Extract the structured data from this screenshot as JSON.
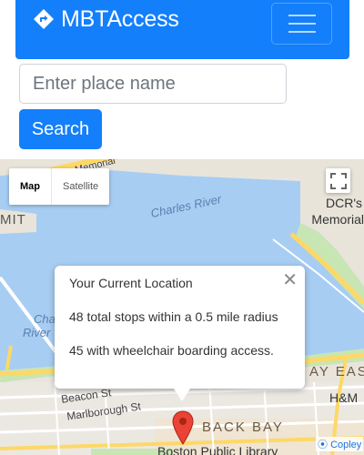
{
  "navbar": {
    "brand_title": "MBTAccess",
    "brand_icon": "directions-icon",
    "toggler_icon": "hamburger-menu-icon",
    "color": "#137ffb"
  },
  "search": {
    "placeholder": "Enter place name",
    "value": "",
    "button_label": "Search"
  },
  "map": {
    "type_controls": {
      "map_label": "Map",
      "satellite_label": "Satellite",
      "selected": "Map"
    },
    "fullscreen_icon": "fullscreen-icon",
    "labels": {
      "memorial_dr": "Memorial",
      "mit": "MIT",
      "charles_river": "Charles River",
      "dcr": "DCR's",
      "memorial": "Memorial",
      "charles_river_partial_1": "Cha",
      "charles_river_partial_2": "River",
      "back_bay_east": "AY EAS",
      "hm": "H&M",
      "beacon_st": "Beacon St",
      "marlborough_st": "Marlborough St",
      "back_bay": "BACK BAY",
      "boston_public_library": "Boston Public Library",
      "copley": "Copley"
    },
    "info_window": {
      "title": "Your Current Location",
      "stops_line": "48 total stops within a 0.5 mile radius",
      "wheelchair_line": "45 with wheelchair boarding access.",
      "close_icon": "close-icon"
    },
    "marker_icon": "map-pin-icon",
    "colors": {
      "water": "#a7cdf2",
      "road": "#fdd866",
      "park": "#c8e5b4"
    }
  }
}
